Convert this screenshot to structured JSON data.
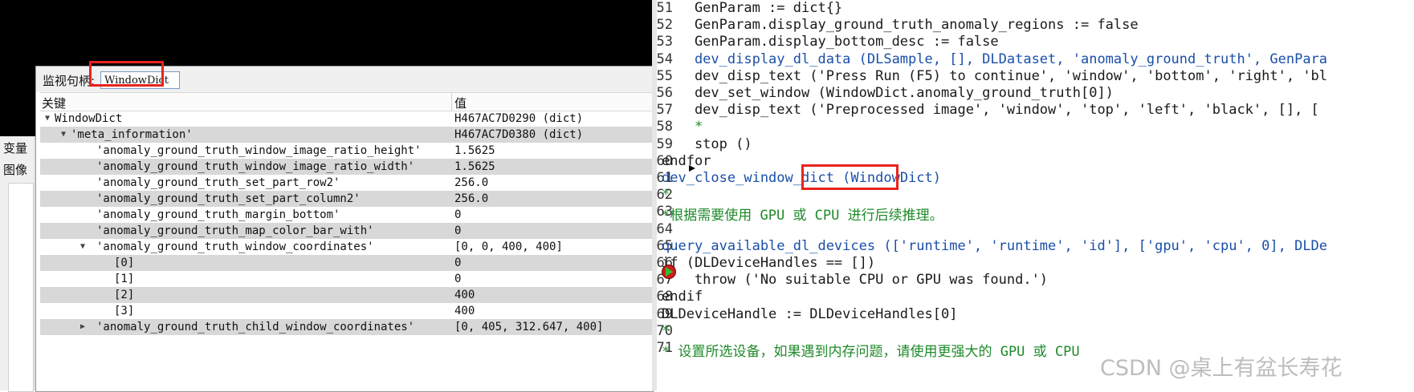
{
  "side_panel": {
    "tab_variables": "变量",
    "tab_image": "图像"
  },
  "watch_window": {
    "title_label": "监视句柄:",
    "title_value": "WindowDict",
    "columns": {
      "key": "关键",
      "value": "值"
    },
    "rows": [
      {
        "key": "WindowDict",
        "value": "H467AC7D0290 (dict)",
        "expand": "down"
      },
      {
        "key": "'meta_information'",
        "value": "H467AC7D0380 (dict)",
        "expand": "down"
      },
      {
        "key": "'anomaly_ground_truth_window_image_ratio_height'",
        "value": "1.5625",
        "expand": ""
      },
      {
        "key": "'anomaly_ground_truth_window_image_ratio_width'",
        "value": "1.5625",
        "expand": ""
      },
      {
        "key": "'anomaly_ground_truth_set_part_row2'",
        "value": "256.0",
        "expand": ""
      },
      {
        "key": "'anomaly_ground_truth_set_part_column2'",
        "value": "256.0",
        "expand": ""
      },
      {
        "key": "'anomaly_ground_truth_margin_bottom'",
        "value": "0",
        "expand": ""
      },
      {
        "key": "'anomaly_ground_truth_map_color_bar_with'",
        "value": "0",
        "expand": ""
      },
      {
        "key": "'anomaly_ground_truth_window_coordinates'",
        "value": "[0, 0, 400, 400]",
        "expand": "down"
      },
      {
        "key": "[0]",
        "value": "0",
        "expand": ""
      },
      {
        "key": "[1]",
        "value": "0",
        "expand": ""
      },
      {
        "key": "[2]",
        "value": "400",
        "expand": ""
      },
      {
        "key": "[3]",
        "value": "400",
        "expand": ""
      },
      {
        "key": "'anomaly_ground_truth_child_window_coordinates'",
        "value": "[0, 405, 312.647, 400]",
        "expand": "right"
      }
    ]
  },
  "editor": {
    "lines": [
      {
        "num": "51",
        "segments": [
          {
            "text": "    GenParam := dict{}",
            "color": "plain"
          }
        ]
      },
      {
        "num": "52",
        "segments": [
          {
            "text": "    GenParam.display_ground_truth_anomaly_regions := false",
            "color": "plain"
          }
        ]
      },
      {
        "num": "53",
        "segments": [
          {
            "text": "    GenParam.display_bottom_desc := false",
            "color": "plain"
          }
        ]
      },
      {
        "num": "54",
        "segments": [
          {
            "text": "    dev_display_dl_data (DLSample, [], DLDataset, 'anomaly_ground_truth', GenPara",
            "color": "blue"
          }
        ]
      },
      {
        "num": "55",
        "segments": [
          {
            "text": "    dev_disp_text ('Press Run (F5) to continue', 'window', 'bottom', 'right', 'bl",
            "color": "plain"
          }
        ]
      },
      {
        "num": "56",
        "segments": [
          {
            "text": "    dev_set_window (WindowDict.anomaly_ground_truth[0])",
            "color": "plain"
          }
        ]
      },
      {
        "num": "57",
        "segments": [
          {
            "text": "    dev_disp_text ('Preprocessed image', 'window', 'top', 'left', 'black', [], [",
            "color": "plain"
          }
        ]
      },
      {
        "num": "58",
        "segments": [
          {
            "text": "    *",
            "color": "green"
          }
        ]
      },
      {
        "num": "59",
        "segments": [
          {
            "text": "    stop ()",
            "color": "plain"
          }
        ]
      },
      {
        "num": "60",
        "segments": [
          {
            "text": "endfor",
            "color": "plain"
          }
        ]
      },
      {
        "num": "61",
        "segments": [
          {
            "text": "dev_close_window_dict ",
            "color": "blue"
          },
          {
            "text": "(WindowDict)",
            "color": "blue"
          }
        ]
      },
      {
        "num": "62",
        "segments": [
          {
            "text": "*",
            "color": "green"
          }
        ]
      },
      {
        "num": "63",
        "segments": [
          {
            "text": "*根据需要使用 GPU 或 CPU 进行后续推理。",
            "color": "green"
          }
        ]
      },
      {
        "num": "64",
        "segments": [
          {
            "text": "",
            "color": "plain"
          }
        ]
      },
      {
        "num": "65",
        "segments": [
          {
            "text": "query_available_dl_devices (['runtime', 'runtime', 'id'], ['gpu', 'cpu', 0], DLDe",
            "color": "blue"
          }
        ]
      },
      {
        "num": "66",
        "segments": [
          {
            "text": "if (DLDeviceHandles == [])",
            "color": "plain"
          }
        ]
      },
      {
        "num": "67",
        "segments": [
          {
            "text": "    throw ('No suitable CPU or GPU was found.')",
            "color": "plain"
          }
        ]
      },
      {
        "num": "68",
        "segments": [
          {
            "text": "endif",
            "color": "plain"
          }
        ]
      },
      {
        "num": "69",
        "segments": [
          {
            "text": "DLDeviceHandle := DLDeviceHandles[0]",
            "color": "plain"
          }
        ]
      },
      {
        "num": "70",
        "segments": [
          {
            "text": "*",
            "color": "green"
          }
        ]
      },
      {
        "num": "71",
        "segments": [
          {
            "text": "* 设置所选设备，如果遇到内存问题，请使用更强大的 GPU 或 CPU",
            "color": "green"
          }
        ]
      }
    ]
  },
  "watermark": "CSDN @桌上有盆长寿花",
  "colors": {
    "highlight_box": "#e8231c",
    "keyword_blue": "#1a4fa8",
    "comment_green": "#1f8a2a",
    "breakpoint": "#c81e1e"
  },
  "icons": {
    "breakpoint": "breakpoint-arrow-icon",
    "current_line": "execution-pointer-icon",
    "expand": "triangle-expand-icon"
  }
}
